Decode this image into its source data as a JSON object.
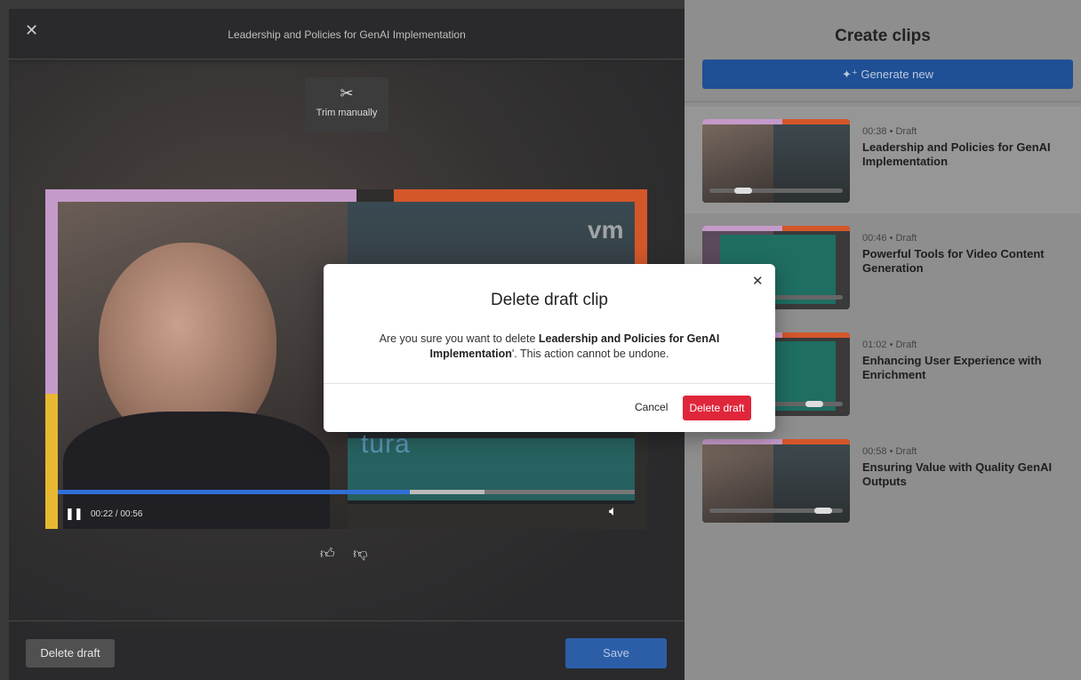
{
  "editor": {
    "title": "Leadership and Policies for GenAI Implementation",
    "close_icon": "close-icon",
    "trim": {
      "icon": "✂",
      "label": "Trim manually"
    },
    "player": {
      "play_icon": "pause-icon",
      "time": "00:22 / 00:56",
      "progress": 0.61
    },
    "feedback": {
      "like_icon": "thumbs-up-icon",
      "dislike_icon": "thumbs-down-icon"
    },
    "delete_draft_label": "Delete draft",
    "save_label": "Save"
  },
  "clips_panel": {
    "title": "Create clips",
    "generate_label": "Generate new",
    "clips": [
      {
        "duration": "00:38 • Draft",
        "title": "Leadership and Policies for GenAI Implementation"
      },
      {
        "duration": "00:46 • Draft",
        "title": "Powerful Tools for Video Content Generation"
      },
      {
        "duration": "01:02 • Draft",
        "title": "Enhancing User Experience with Enrichment"
      },
      {
        "duration": "00:58 • Draft",
        "title": "Ensuring Value with Quality GenAI Outputs"
      }
    ]
  },
  "modal": {
    "title": "Delete draft clip",
    "body_prefix": "Are you sure you want to delete ",
    "body_bold": "Leadership and Policies for GenAI Implementation",
    "body_suffix": "'. This action cannot be undone.",
    "cancel_label": "Cancel",
    "delete_label": "Delete draft"
  },
  "colors": {
    "accent_blue": "#2f6fd6",
    "danger_red": "#e0263b"
  }
}
